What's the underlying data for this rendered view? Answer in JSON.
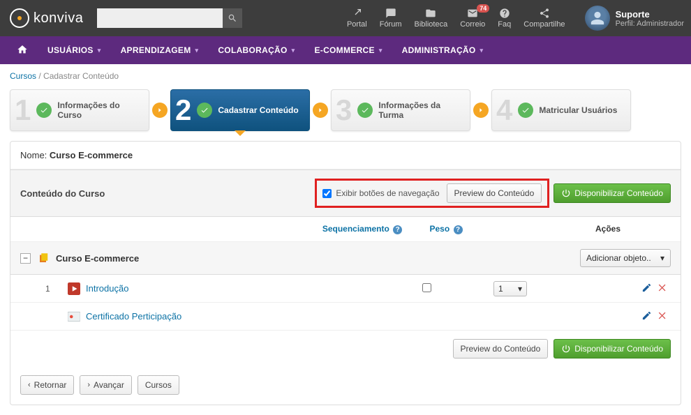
{
  "brand": {
    "name": "konviva"
  },
  "topnav": {
    "portal": "Portal",
    "forum": "Fórum",
    "biblioteca": "Biblioteca",
    "correio": "Correio",
    "correio_badge": "74",
    "faq": "Faq",
    "compartilhe": "Compartilhe"
  },
  "user": {
    "name": "Suporte",
    "profile": "Perfil: Administrador"
  },
  "nav": {
    "usuarios": "USUÁRIOS",
    "aprendizagem": "APRENDIZAGEM",
    "colaboracao": "COLABORAÇÃO",
    "ecommerce": "E-COMMERCE",
    "administracao": "ADMINISTRAÇÃO"
  },
  "breadcrumb": {
    "root": "Cursos",
    "current": "Cadastrar Conteúdo"
  },
  "wizard": {
    "step1": "Informações do Curso",
    "step2": "Cadastrar Conteúdo",
    "step3": "Informações da Turma",
    "step4": "Matricular Usuários",
    "n1": "1",
    "n2": "2",
    "n3": "3",
    "n4": "4"
  },
  "content": {
    "name_label": "Nome:",
    "name_value": "Curso E-commerce",
    "section_title": "Conteúdo do Curso",
    "show_nav_buttons": "Exibir botões de navegação",
    "preview_btn": "Preview do Conteúdo",
    "publish_btn": "Disponibilizar Conteúdo",
    "col_seq": "Sequenciamento",
    "col_peso": "Peso",
    "col_acoes": "Ações",
    "course_title": "Curso E-commerce",
    "add_object_label": "Adicionar objeto..",
    "item1_label": "Introdução",
    "item1_order": "1",
    "item1_peso": "1",
    "item2_label": "Certificado Perticipação",
    "back_btn": "Retornar",
    "next_btn": "Avançar",
    "courses_btn": "Cursos"
  }
}
